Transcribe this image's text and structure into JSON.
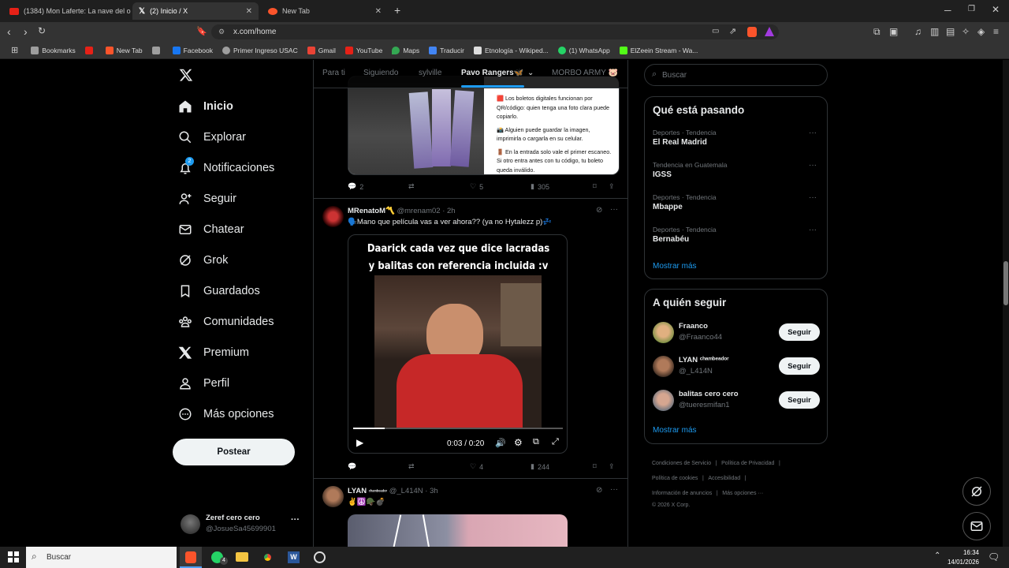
{
  "browser": {
    "tabs": [
      {
        "label": "(1384) Mon Laferte: La nave del olvid",
        "color": "#e62117"
      },
      {
        "label": "(2) Inicio / X",
        "color": "#000000"
      },
      {
        "label": "New Tab",
        "color": "#fb542b"
      }
    ],
    "new_tab_symbol": "+",
    "url": "x.com/home",
    "bookmarks": [
      {
        "label": "Bookmarks",
        "color": "#9e9e9e"
      },
      {
        "label": "",
        "color": "#e62117"
      },
      {
        "label": "New Tab",
        "color": "#fb542b"
      },
      {
        "label": "",
        "color": "#9e9e9e"
      },
      {
        "label": "Facebook",
        "color": "#1877f2"
      },
      {
        "label": "Primer Ingreso USAC",
        "color": "#9e9e9e"
      },
      {
        "label": "Gmail",
        "color": "#ea4335"
      },
      {
        "label": "YouTube",
        "color": "#e62117"
      },
      {
        "label": "Maps",
        "color": "#34a853"
      },
      {
        "label": "Traducir",
        "color": "#4285f4"
      },
      {
        "label": "Etnología - Wikiped...",
        "color": "#dddddd"
      },
      {
        "label": "(1) WhatsApp",
        "color": "#25d366"
      },
      {
        "label": "ElZeein Stream - Wa...",
        "color": "#53fc18"
      }
    ]
  },
  "sidebar": {
    "items": [
      {
        "label": "Inicio",
        "icon": "home-icon"
      },
      {
        "label": "Explorar",
        "icon": "search-icon"
      },
      {
        "label": "Notificaciones",
        "icon": "bell-icon",
        "badge": "2"
      },
      {
        "label": "Seguir",
        "icon": "add-person-icon"
      },
      {
        "label": "Chatear",
        "icon": "mail-icon"
      },
      {
        "label": "Grok",
        "icon": "grok-icon"
      },
      {
        "label": "Guardados",
        "icon": "bookmark-icon"
      },
      {
        "label": "Comunidades",
        "icon": "communities-icon"
      },
      {
        "label": "Premium",
        "icon": "x-icon"
      },
      {
        "label": "Perfil",
        "icon": "person-icon"
      },
      {
        "label": "Más opciones",
        "icon": "more-circle-icon"
      }
    ],
    "post_button": "Postear",
    "account": {
      "name": "Zeref cero cero",
      "handle": "@JosueSa45699901",
      "more": "···"
    }
  },
  "timeline": {
    "tabs": [
      "Para ti",
      "Siguiendo",
      "sylville",
      "Pavo Rangers🦋",
      "MORBO ARMY 🐷"
    ],
    "post1": {
      "bullets": [
        "🟥 Los boletos digitales funcionan por QR/código: quien tenga una foto clara puede copiarlo.",
        "📸 Alguien puede guardar la imagen, imprimirla o cargarla en su celular.",
        "🚪 En la entrada solo vale el primer escaneo. Si otro entra antes con tu código, tu boleto queda inválido."
      ],
      "replies": "2",
      "reposts": "",
      "likes": "5",
      "views": "305"
    },
    "post2": {
      "name": "MRenatoM〽️",
      "handle": "@mrenam02",
      "time": "· 2h",
      "text": "🗣️Mano que película vas a ver ahora?? (ya no Hytalezz p)💤",
      "video_caption": "Daarick cada vez que dice lacradas y balitas con referencia incluida :v",
      "video_time": "0:03 / 0:20",
      "video_progress": 0.15,
      "replies": "",
      "reposts": "",
      "likes": "4",
      "views": "244"
    },
    "post3": {
      "name": "LYAN",
      "name_tag": "ᶜʰᵃᵐᵇᵉᵃᵈᵒʳ",
      "handle": "@_L414N",
      "time": "· 3h",
      "text": "✌️☮️🪖💣"
    }
  },
  "right": {
    "search_placeholder": "Buscar",
    "trends_title": "Qué está pasando",
    "trends": [
      {
        "context": "Deportes · Tendencia",
        "name": "El Real Madrid"
      },
      {
        "context": "Tendencia en Guatemala",
        "name": "IGSS"
      },
      {
        "context": "Deportes · Tendencia",
        "name": "Mbappe"
      },
      {
        "context": "Deportes · Tendencia",
        "name": "Bernabéu"
      }
    ],
    "show_more": "Mostrar más",
    "who_title": "A quién seguir",
    "who": [
      {
        "name": "Fraanco",
        "handle": "@Fraanco44",
        "button": "Seguir"
      },
      {
        "name": "LYAN ᶜʰᵃᵐᵇᵉᵃᵈᵒʳ",
        "handle": "@_L414N",
        "button": "Seguir"
      },
      {
        "name": "balitas cero cero",
        "handle": "@tueresmifan1",
        "button": "Seguir"
      }
    ],
    "footer": [
      "Condiciones de Servicio",
      "Política de Privacidad",
      "Política de cookies",
      "Accesibilidad",
      "Información de anuncios",
      "Más opciones ···",
      "© 2026 X Corp."
    ]
  },
  "taskbar": {
    "search": "Buscar",
    "time": "16:34",
    "date": "14/01/2026",
    "whatsapp_badge": "4"
  }
}
